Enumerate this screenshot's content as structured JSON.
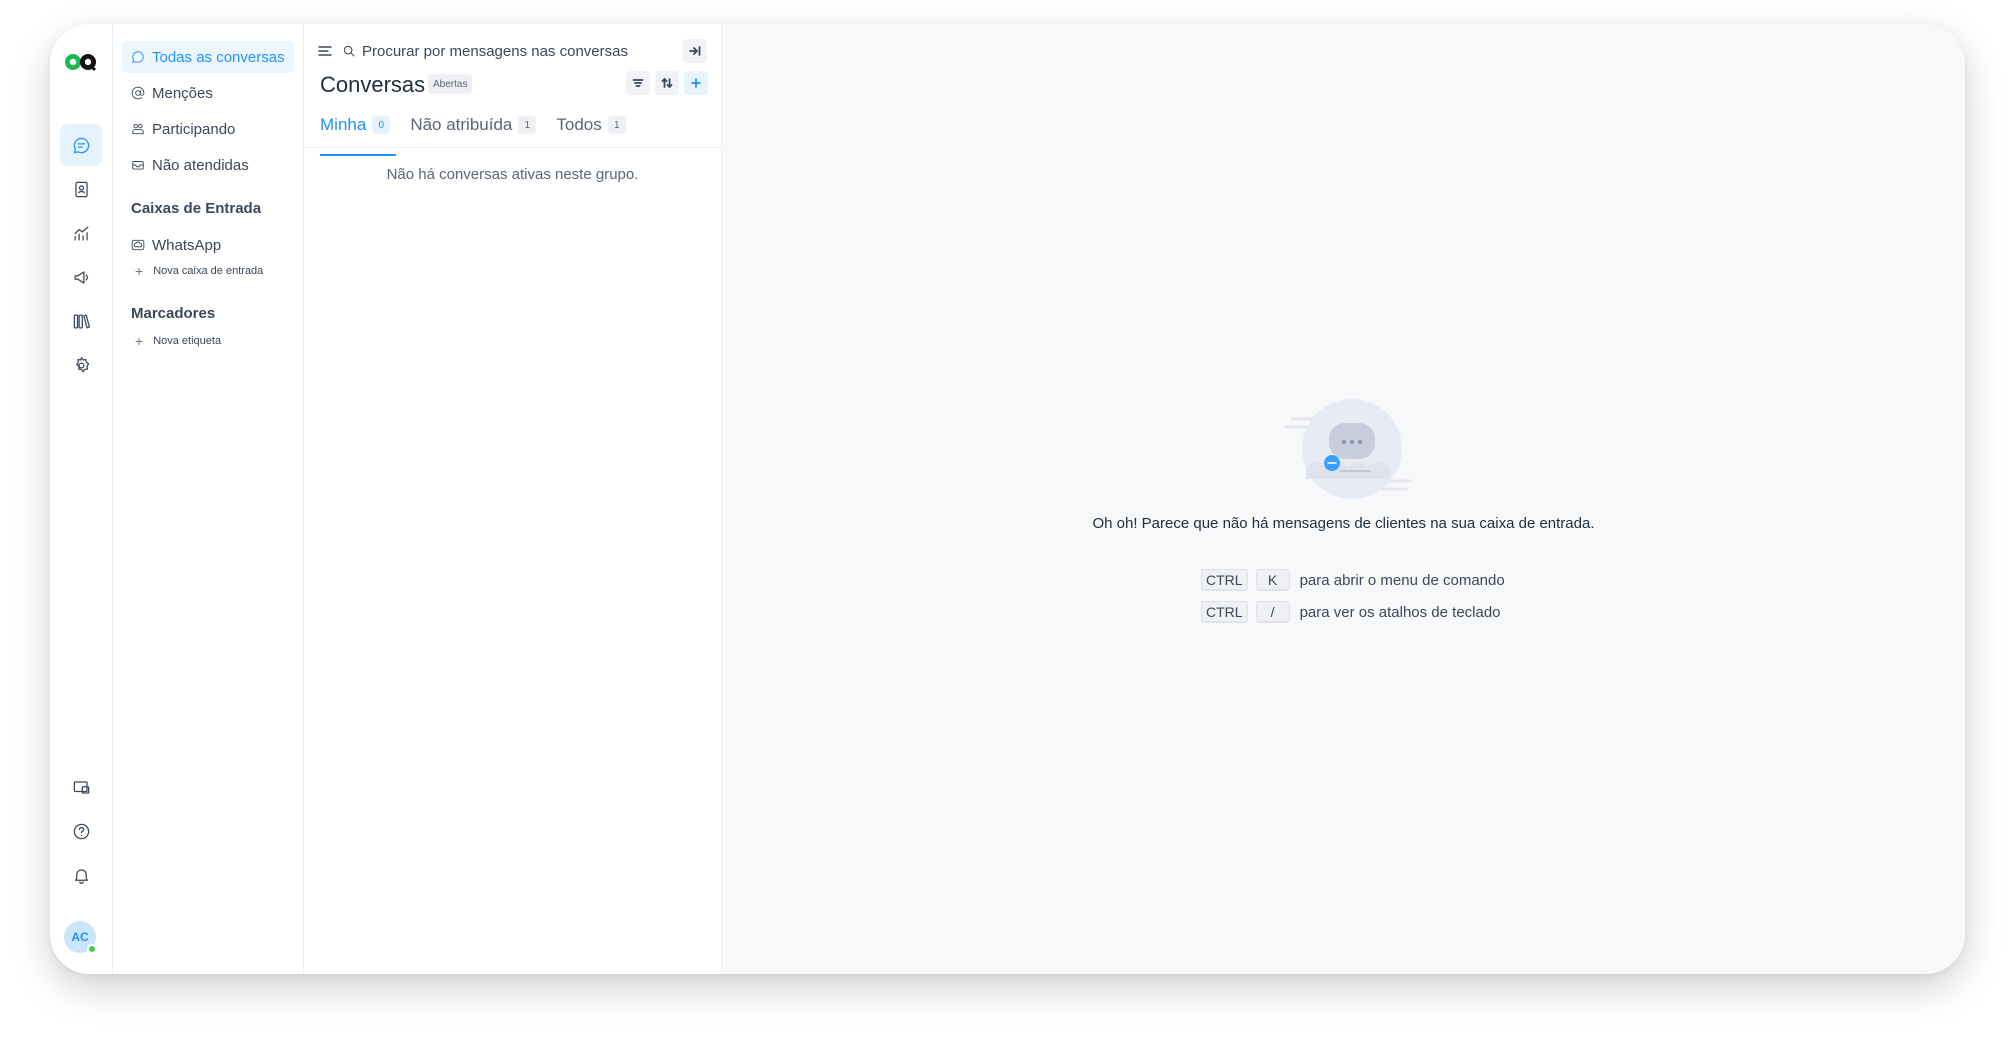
{
  "rail": {
    "items": [
      {
        "name": "conversations-icon"
      },
      {
        "name": "contacts-icon"
      },
      {
        "name": "reports-icon"
      },
      {
        "name": "campaigns-icon"
      },
      {
        "name": "library-icon"
      },
      {
        "name": "settings-icon"
      }
    ],
    "bottom": [
      {
        "name": "dashboard-apps-icon"
      },
      {
        "name": "help-icon"
      },
      {
        "name": "notifications-icon"
      }
    ],
    "avatar_initials": "AC"
  },
  "sidebar": {
    "items": [
      {
        "label": "Todas as conversas",
        "icon": "chat-icon",
        "active": true
      },
      {
        "label": "Menções",
        "icon": "at-icon"
      },
      {
        "label": "Participando",
        "icon": "participants-icon"
      },
      {
        "label": "Não atendidas",
        "icon": "mail-unread-icon"
      }
    ],
    "inboxes_heading": "Caixas de Entrada",
    "inboxes": [
      {
        "label": "WhatsApp",
        "icon": "cloud-icon"
      }
    ],
    "new_inbox": "Nova caixa de entrada",
    "labels_heading": "Marcadores",
    "new_label": "Nova etiqueta"
  },
  "list": {
    "search_placeholder": "Procurar por mensagens nas conversas",
    "title": "Conversas",
    "status": "Abertas",
    "tabs": [
      {
        "label": "Minha",
        "count": "0",
        "active": true
      },
      {
        "label": "Não atribuída",
        "count": "1"
      },
      {
        "label": "Todos",
        "count": "1"
      }
    ],
    "empty_text": "Não há conversas ativas neste grupo."
  },
  "main": {
    "empty_message": "Oh oh! Parece que não há mensagens de clientes na sua caixa de entrada.",
    "shortcuts": [
      {
        "keys": [
          "CTRL",
          "K"
        ],
        "desc": "para abrir o menu de comando"
      },
      {
        "keys": [
          "CTRL",
          "/"
        ],
        "desc": "para ver os atalhos de teclado"
      }
    ]
  },
  "colors": {
    "accent": "#1f93ff",
    "logo_green": "#1db954",
    "online": "#44ce4b"
  }
}
